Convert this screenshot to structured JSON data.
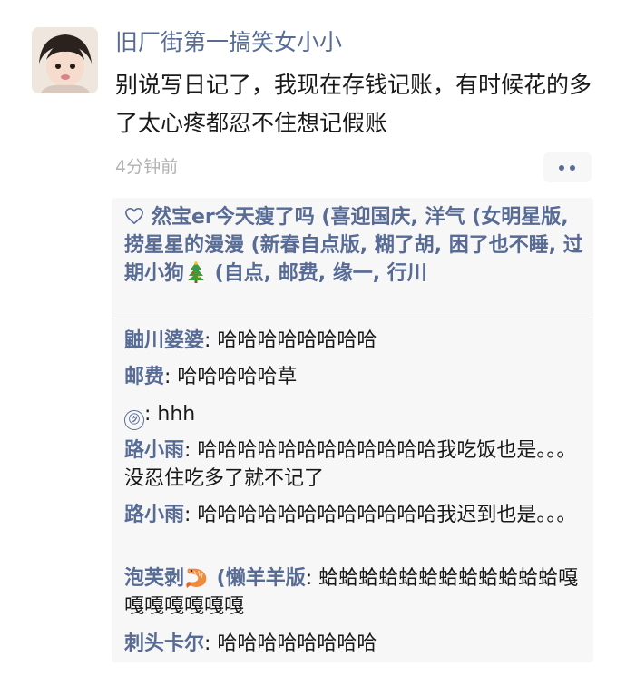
{
  "post": {
    "author": "旧厂街第一搞笑女小小",
    "text": "别说写日记了，我现在存钱记账，有时候花的多了太心疼都忍不住想记假账",
    "time": "4分钟前",
    "more_label": "••"
  },
  "likes": {
    "line": "然宝er今天瘦了吗 (喜迎国庆, 洋气 (女明星版, 捞星星的漫漫 (新春自点版, 糊了胡, 困了也不睡, 过期小狗",
    "after_tree": " (自点, 邮费, 缘一, 行川"
  },
  "comments": [
    {
      "author": "鼬川婆婆",
      "sep": ": ",
      "text": "哈哈哈哈哈哈哈哈"
    },
    {
      "author": "邮费",
      "sep": ": ",
      "text": "哈哈哈哈哈草"
    },
    {
      "author": "㋡",
      "sep": ": ",
      "text": "hhh"
    },
    {
      "author": "路小雨",
      "sep": ": ",
      "text": "哈哈哈哈哈哈哈哈哈哈哈哈我吃饭也是。。。没忍住吃多了就不记了"
    },
    {
      "author": "路小雨",
      "sep": ": ",
      "text": "哈哈哈哈哈哈哈哈哈哈哈哈我迟到也是。。。"
    },
    {
      "author": "泡芙剥",
      "author_suffix": " (懒羊羊版",
      "sep": ": ",
      "text": "蛤蛤蛤蛤蛤蛤蛤蛤蛤蛤蛤蛤嘎嘎嘎嘎嘎嘎嘎"
    },
    {
      "author": "刺头卡尔",
      "sep": ": ",
      "text": "哈哈哈哈哈哈哈哈"
    }
  ],
  "colors": {
    "link": "#576b95",
    "text": "#191919",
    "muted": "#b2b2b2",
    "panel": "#f7f7f7"
  },
  "icons": [
    "heart-outline-icon",
    "christmas-tree-emoji",
    "shrimp-emoji",
    "circle-smiley-icon",
    "more-dots-icon"
  ]
}
